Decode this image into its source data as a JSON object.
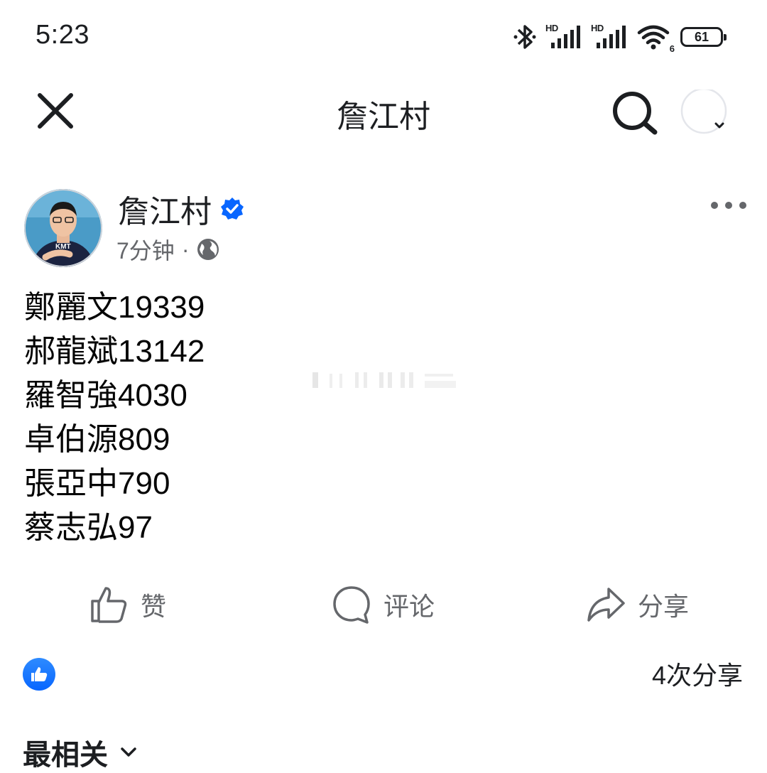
{
  "status_bar": {
    "time": "5:23",
    "network_label_1": "HD",
    "network_label_2": "HD",
    "wifi_label": "6",
    "battery": "61"
  },
  "header": {
    "title": "詹江村",
    "icons": [
      "close-icon",
      "search-icon",
      "profile-menu-icon"
    ]
  },
  "post": {
    "author": "詹江村",
    "verified": true,
    "time": "7分钟",
    "separator": "·",
    "audience_icon": "globe-icon",
    "lines": [
      "鄭麗文19339",
      "郝龍斌13142",
      "羅智強4030",
      "卓伯源809",
      "張亞中790",
      "蔡志弘97"
    ]
  },
  "actions": {
    "like": "赞",
    "comment": "评论",
    "share": "分享"
  },
  "reactions": {
    "icon": "like-reaction-icon",
    "shares": "4次分享"
  },
  "comments": {
    "sort_label": "最相关"
  },
  "colors": {
    "accent": "#0866ff",
    "text": "#1c1e21",
    "secondary": "#65676b"
  }
}
